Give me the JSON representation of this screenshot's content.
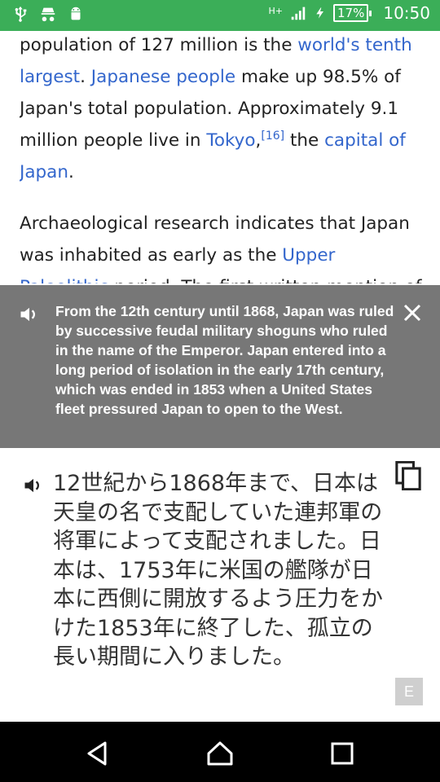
{
  "status_bar": {
    "left_icons": [
      "usb-icon",
      "incognito-icon",
      "android-icon"
    ],
    "network": "H+",
    "battery": "17%",
    "time": "10:50"
  },
  "article": {
    "p1_t1": "population of 127 million is the ",
    "p1_l1": "world's tenth largest",
    "p1_t2": ". ",
    "p1_l2": "Japanese people",
    "p1_t3": " make up 98.5% of Japan's total population. Approximately 9.1 million people live in ",
    "p1_l3": "Tokyo",
    "p1_t4": ",",
    "p1_ref": "[16]",
    "p1_t5": " the ",
    "p1_l4": "capital of Japan",
    "p1_t6": ".",
    "p2_t1": "Archaeological research indicates that Japan was inhabited as early as the ",
    "p2_l1": "Upper Paleolithic",
    "p2_t2": " period. The first written mention of"
  },
  "overlay": {
    "source_text": "From the 12th century until 1868, Japan was ruled by successive feudal military shoguns who ruled in the name of the Emperor. Japan entered into a long period of isolation in the early 17th century, which was ended in 1853 when a United States fleet pressured Japan to open to the West."
  },
  "translation": {
    "text": "12世紀から1868年まで、日本は天皇の名で支配していた連邦軍の将軍によって支配されました。日本は、1753年に米国の艦隊が日本に西側に開放するよう圧力をかけた1853年に終了した、孤立の長い期間に入りました。",
    "badge": "E"
  },
  "colors": {
    "status_bar": "#3bae58",
    "link": "#3366cc",
    "overlay": "#777777"
  }
}
